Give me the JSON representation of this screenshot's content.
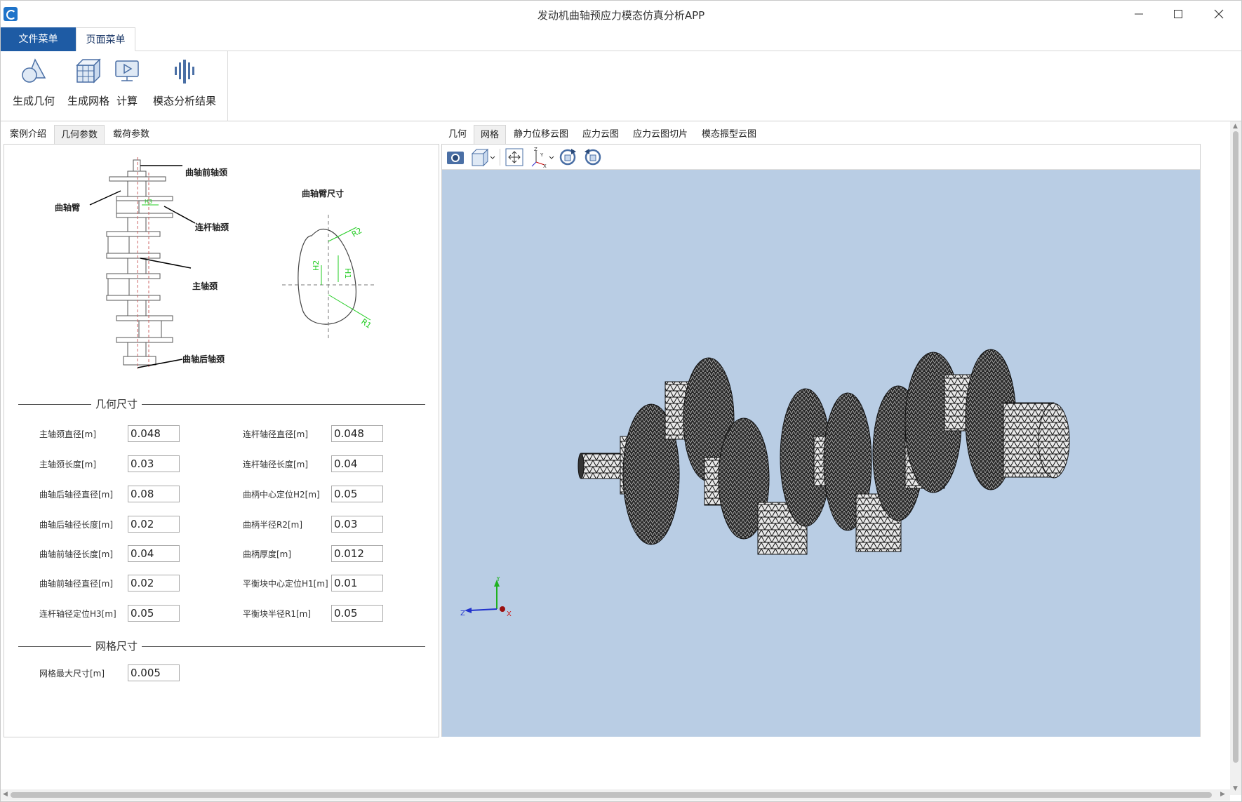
{
  "window": {
    "title": "发动机曲轴预应力模态仿真分析APP"
  },
  "ribbon": {
    "tabs": [
      "文件菜单",
      "页面菜单"
    ],
    "buttons": [
      {
        "label": "生成几何",
        "icon": "geometry-icon"
      },
      {
        "label": "生成网格",
        "icon": "mesh-icon"
      },
      {
        "label": "计算",
        "icon": "compute-icon"
      },
      {
        "label": "模态分析结果",
        "icon": "modal-results-icon"
      }
    ]
  },
  "left": {
    "tabs": [
      "案例介绍",
      "几何参数",
      "载荷参数"
    ],
    "active_tab": "几何参数",
    "diagram": {
      "labels": {
        "front_journal": "曲轴前轴颈",
        "crank_arm": "曲轴臂",
        "conrod_journal": "连杆轴颈",
        "main_journal": "主轴颈",
        "rear_journal": "曲轴后轴颈",
        "arm_size_title": "曲轴臂尺寸",
        "h3": "H3",
        "h1": "H1",
        "h2": "H2",
        "r1": "R1",
        "r2": "R2"
      }
    },
    "geometry_section": "几何尺寸",
    "mesh_section": "网格尺寸",
    "params_left": [
      {
        "label": "主轴颈直径[m]",
        "value": "0.048"
      },
      {
        "label": "主轴颈长度[m]",
        "value": "0.03"
      },
      {
        "label": "曲轴后轴径直径[m]",
        "value": "0.08"
      },
      {
        "label": "曲轴后轴径长度[m]",
        "value": "0.02"
      },
      {
        "label": "曲轴前轴径长度[m]",
        "value": "0.04"
      },
      {
        "label": "曲轴前轴径直径[m]",
        "value": "0.02"
      },
      {
        "label": "连杆轴径定位H3[m]",
        "value": "0.05"
      }
    ],
    "params_right": [
      {
        "label": "连杆轴径直径[m]",
        "value": "0.048"
      },
      {
        "label": "连杆轴径长度[m]",
        "value": "0.04"
      },
      {
        "label": "曲柄中心定位H2[m]",
        "value": "0.05"
      },
      {
        "label": "曲柄半径R2[m]",
        "value": "0.03"
      },
      {
        "label": "曲柄厚度[m]",
        "value": "0.012"
      },
      {
        "label": "平衡块中心定位H1[m]",
        "value": "0.01"
      },
      {
        "label": "平衡块半径R1[m]",
        "value": "0.05"
      }
    ],
    "mesh_param": {
      "label": "网格最大尺寸[m]",
      "value": "0.005"
    }
  },
  "right": {
    "tabs": [
      "几何",
      "网格",
      "静力位移云图",
      "应力云图",
      "应力云图切片",
      "模态振型云图"
    ],
    "active_tab": "网格",
    "toolbar": [
      "camera-icon",
      "view-cube-icon",
      "fit-view-icon",
      "axes-icon",
      "rotate-cw-icon",
      "rotate-ccw-icon"
    ],
    "viewport_bg": "#b9cde4",
    "triad": {
      "x": "X",
      "y": "Y",
      "z": "Z"
    }
  },
  "colors": {
    "accent": "#1e5ba4"
  }
}
